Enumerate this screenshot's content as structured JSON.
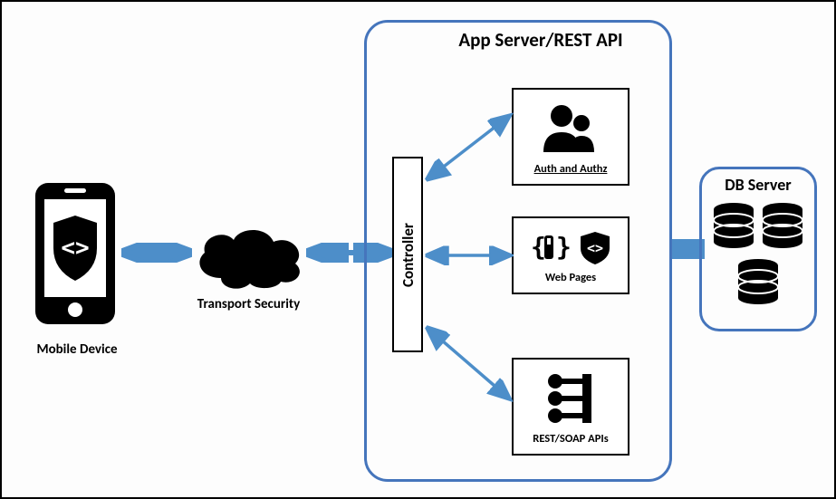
{
  "labels": {
    "mobile": "Mobile Device",
    "transport": "Transport Security",
    "appserver": "App Server/REST API",
    "controller": "Controller",
    "auth": "Auth and Authz",
    "web": "Web Pages",
    "api": "REST/SOAP  APIs",
    "db": "DB Server"
  },
  "colors": {
    "containerBorder": "#4575bc",
    "arrow": "#4d8ec9",
    "black": "#000000"
  }
}
